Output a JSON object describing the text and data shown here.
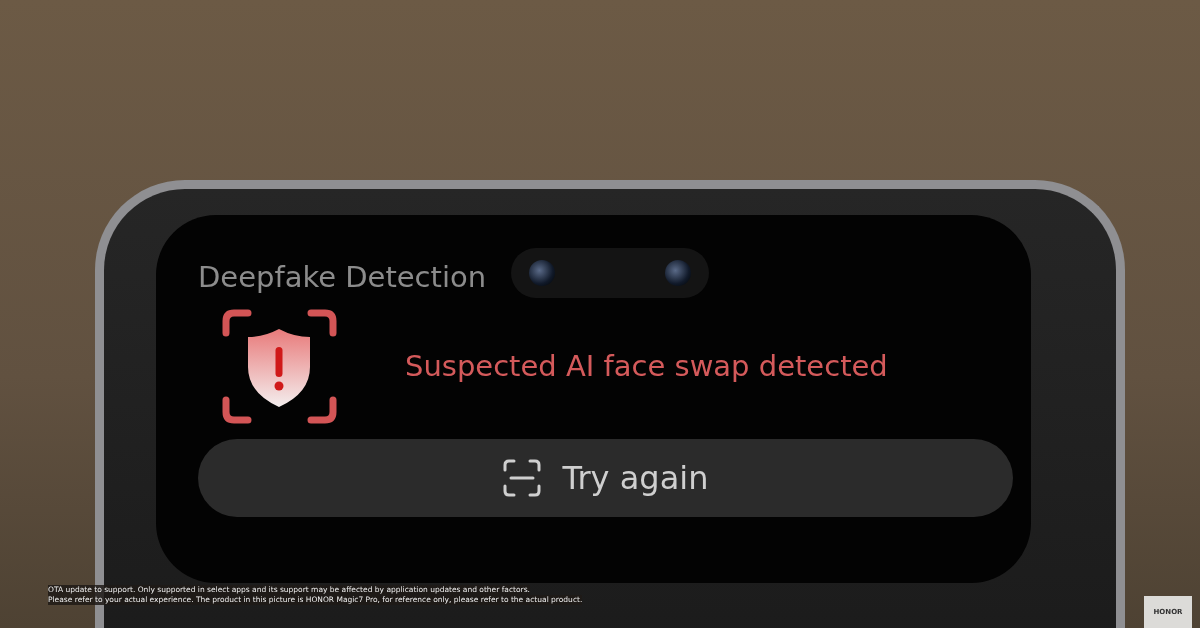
{
  "popup": {
    "title": "Deepfake Detection",
    "alert": "Suspected AI face swap detected",
    "button": "Try again"
  },
  "disclaimer": [
    "OTA update to support. Only supported in select apps and its support may be affected by application updates and other factors.",
    "Please refer to your actual experience. The product in this picture is HONOR Magic7 Pro, for reference only, please refer to the actual product."
  ],
  "brand": "HONOR"
}
